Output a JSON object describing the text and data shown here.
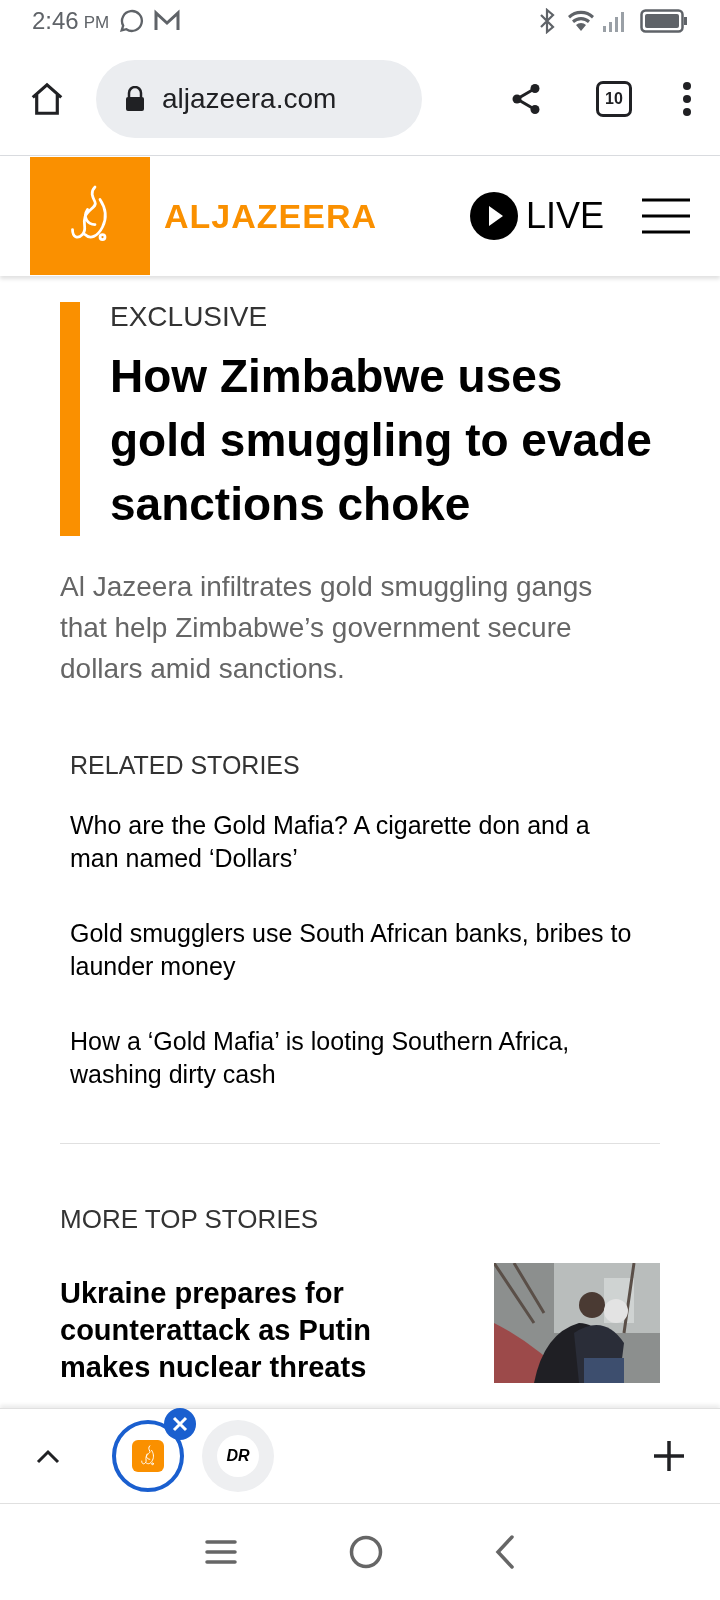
{
  "status_bar": {
    "time": "2:46",
    "ampm": "PM"
  },
  "browser": {
    "url": "aljazeera.com",
    "tab_count": "10"
  },
  "site_header": {
    "brand": "ALJAZEERA",
    "live": "LIVE"
  },
  "article": {
    "kicker": "EXCLUSIVE",
    "headline": "How Zimbabwe uses gold smuggling to evade sanctions choke",
    "summary": "Al Jazeera infiltrates gold smuggling gangs that help Zimbabwe’s government secure dollars amid sanctions."
  },
  "related": {
    "title": "RELATED STORIES",
    "items": [
      "Who are the Gold Mafia? A cigarette don and a man named ‘Dollars’",
      "Gold smugglers use South African banks, bribes to launder money",
      "How a ‘Gold Mafia’ is looting Southern Africa, washing dirty cash"
    ]
  },
  "more": {
    "title": "MORE TOP STORIES",
    "stories": [
      {
        "headline": "Ukraine prepares for counterattack as Putin makes nuclear threats",
        "kind": "picture"
      }
    ]
  },
  "tab_strip": {
    "tabs": [
      {
        "kind": "logo",
        "selected": true
      },
      {
        "kind": "text",
        "label": "DR",
        "selected": false
      }
    ]
  }
}
